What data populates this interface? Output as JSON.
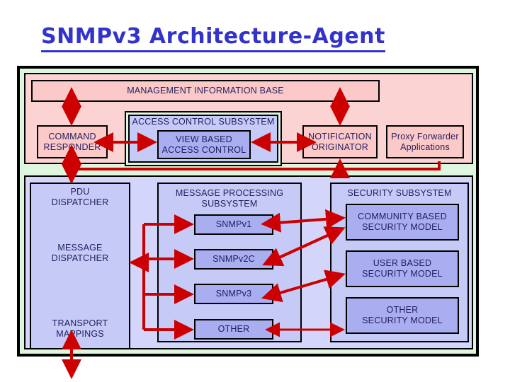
{
  "page": {
    "title": "SNMPv3 Architecture-Agent"
  },
  "colors": {
    "title": "#3333cc",
    "applications_area": "#fcd3d3",
    "engine_area": "#d3d6fa",
    "frame_background": "#ddf6dd",
    "connector": "#cc0000",
    "box_outline": "#000000",
    "text": "#221d5e"
  },
  "applications": {
    "mib": {
      "label": "MANAGEMENT INFORMATION BASE"
    },
    "command_responder": {
      "label": "COMMAND\nRESPONDER",
      "line1": "COMMAND",
      "line2": "RESPONDER"
    },
    "notification_originator": {
      "line1": "NOTIFICATION",
      "line2": "ORIGINATOR"
    },
    "proxy_forwarder": {
      "line1": "Proxy Forwarder",
      "line2": "Applications"
    }
  },
  "access_control_subsystem": {
    "label": "ACCESS CONTROL SUBSYSTEM",
    "view_based_access_control": {
      "line1": "VIEW BASED",
      "line2": "ACCESS CONTROL"
    }
  },
  "dispatcher": {
    "pdu_dispatcher": {
      "line1": "PDU",
      "line2": "DISPATCHER"
    },
    "message_dispatcher": {
      "line1": "MESSAGE",
      "line2": "DISPATCHER"
    },
    "transport_mappings": {
      "line1": "TRANSPORT",
      "line2": "MAPPINGS"
    }
  },
  "message_processing_subsystem": {
    "label_line1": "MESSAGE PROCESSING",
    "label_line2": "SUBSYSTEM",
    "models": [
      {
        "label": "SNMPv1"
      },
      {
        "label": "SNMPv2C"
      },
      {
        "label": "SNMPv3"
      },
      {
        "label": "OTHER"
      }
    ]
  },
  "security_subsystem": {
    "label": "SECURITY SUBSYSTEM",
    "models": [
      {
        "line1": "COMMUNITY BASED",
        "line2": "SECURITY MODEL"
      },
      {
        "line1": "USER BASED",
        "line2": "SECURITY MODEL"
      },
      {
        "line1": "OTHER",
        "line2": "SECURITY MODEL"
      }
    ]
  }
}
